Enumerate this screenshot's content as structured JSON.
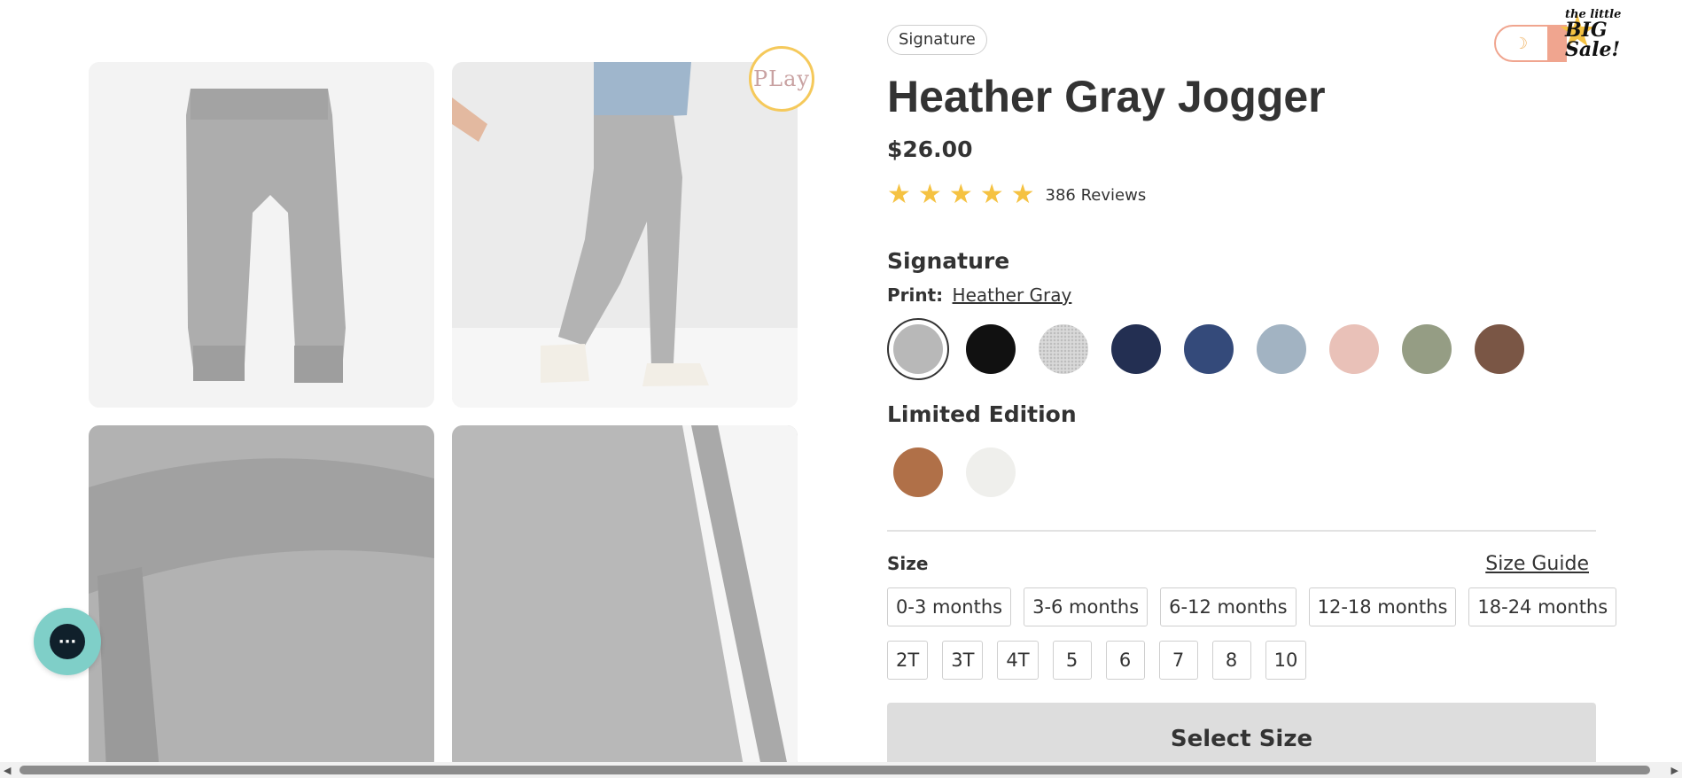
{
  "gallery": {
    "images": [
      {
        "name": "flat-lay-jogger-image"
      },
      {
        "name": "child-wearing-jogger-image"
      },
      {
        "name": "waistband-closeup-image"
      },
      {
        "name": "fabric-closeup-image"
      }
    ],
    "play_badge": "PLay"
  },
  "chat": {
    "icon": "chat-icon",
    "glyph": "···"
  },
  "product": {
    "collection_pill": "Signature",
    "title": "Heather Gray Jogger",
    "price": "$26.00",
    "rating": {
      "stars": 5,
      "star_glyph": "★",
      "reviews_label": "386 Reviews"
    },
    "signature_heading": "Signature",
    "print_label": "Print:",
    "print_value": "Heather Gray",
    "signature_swatches": [
      {
        "name": "Heather Gray",
        "color": "#b8b8b8",
        "selected": true
      },
      {
        "name": "Black",
        "color": "#111111"
      },
      {
        "name": "Light Heather",
        "color": "#d9d9d9",
        "speckle": true
      },
      {
        "name": "Navy",
        "color": "#232f52"
      },
      {
        "name": "Indigo",
        "color": "#344a7a"
      },
      {
        "name": "Dusty Blue",
        "color": "#a2b3c2"
      },
      {
        "name": "Blush",
        "color": "#e9c1b8"
      },
      {
        "name": "Sage",
        "color": "#959d84"
      },
      {
        "name": "Brown",
        "color": "#7a5645"
      }
    ],
    "limited_heading": "Limited Edition",
    "limited_swatches": [
      {
        "name": "Rust",
        "color": "#b07048"
      },
      {
        "name": "Cream",
        "color": "#efefec"
      }
    ],
    "size_label": "Size",
    "size_guide": "Size Guide",
    "sizes_row1": [
      "0-3 months",
      "3-6 months",
      "6-12 months",
      "12-18 months",
      "18-24 months"
    ],
    "sizes_row2": [
      "2T",
      "3T",
      "4T",
      "5",
      "6",
      "7",
      "8",
      "10"
    ],
    "cta": "Select Size"
  },
  "promo": {
    "small": "the little",
    "big1": "BIG",
    "big2": "Sale!",
    "moon": "☽"
  },
  "scrollbar": {
    "left_arrow": "◀",
    "right_arrow": "▶"
  }
}
